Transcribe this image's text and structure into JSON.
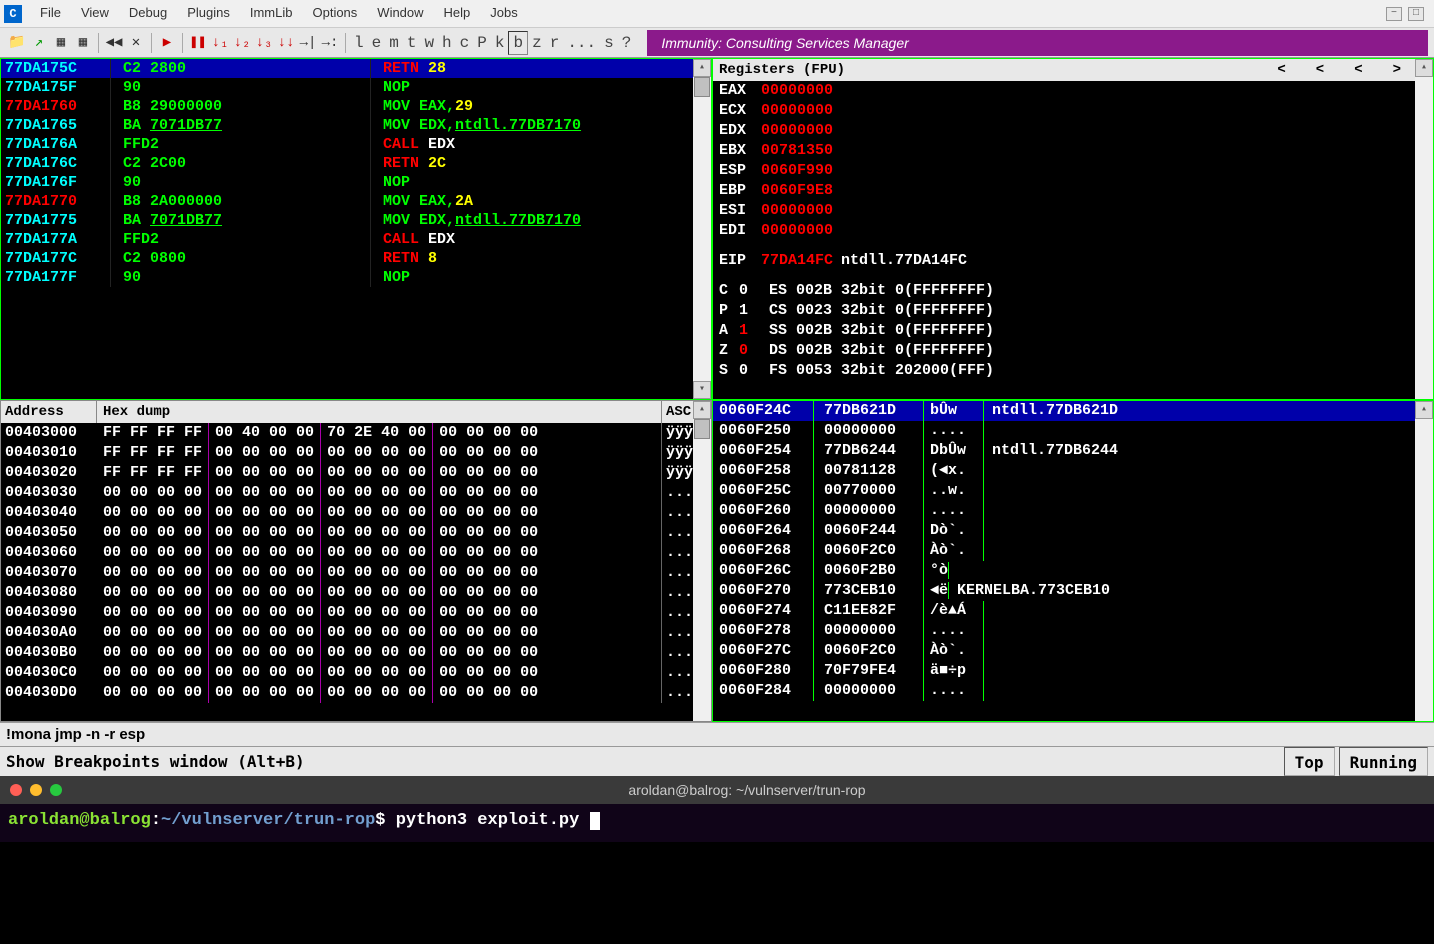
{
  "app_icon_letter": "C",
  "menu": [
    "File",
    "View",
    "Debug",
    "Plugins",
    "ImmLib",
    "Options",
    "Window",
    "Help",
    "Jobs"
  ],
  "toolbar_letters": [
    "l",
    "e",
    "m",
    "t",
    "w",
    "h",
    "c",
    "P",
    "k",
    "b",
    "z",
    "r",
    "...",
    "s",
    "?"
  ],
  "toolbar_active_letter": "b",
  "branding": "Immunity: Consulting Services Manager",
  "disasm": [
    {
      "addr": "77DA175C",
      "addr_c": "teal",
      "bytes": "C2 2800",
      "instr_parts": [
        {
          "t": "RETN ",
          "c": "red"
        },
        {
          "t": "28",
          "c": "yellow"
        }
      ],
      "sel": true
    },
    {
      "addr": "77DA175F",
      "addr_c": "teal",
      "bytes": "90",
      "instr_parts": [
        {
          "t": "NOP",
          "c": "green"
        }
      ]
    },
    {
      "addr": "77DA1760",
      "addr_c": "red",
      "bytes": "B8 29000000",
      "instr_parts": [
        {
          "t": "MOV EAX,",
          "c": "green"
        },
        {
          "t": "29",
          "c": "yellow"
        }
      ]
    },
    {
      "addr": "77DA1765",
      "addr_c": "teal",
      "bytes": "BA ",
      "bytes2": "7071DB77",
      "instr_parts": [
        {
          "t": "MOV EDX,",
          "c": "green"
        },
        {
          "t": "ntdll.77DB7170",
          "c": "green",
          "u": true
        }
      ]
    },
    {
      "addr": "77DA176A",
      "addr_c": "teal",
      "bytes": "FFD2",
      "instr_parts": [
        {
          "t": "CALL ",
          "c": "red"
        },
        {
          "t": "EDX",
          "c": "white"
        }
      ]
    },
    {
      "addr": "77DA176C",
      "addr_c": "teal",
      "bytes": "C2 2C00",
      "instr_parts": [
        {
          "t": "RETN ",
          "c": "red"
        },
        {
          "t": "2C",
          "c": "yellow"
        }
      ]
    },
    {
      "addr": "77DA176F",
      "addr_c": "teal",
      "bytes": "90",
      "instr_parts": [
        {
          "t": "NOP",
          "c": "green"
        }
      ]
    },
    {
      "addr": "77DA1770",
      "addr_c": "red",
      "bytes": "B8 2A000000",
      "instr_parts": [
        {
          "t": "MOV EAX,",
          "c": "green"
        },
        {
          "t": "2A",
          "c": "yellow"
        }
      ]
    },
    {
      "addr": "77DA1775",
      "addr_c": "teal",
      "bytes": "BA ",
      "bytes2": "7071DB77",
      "instr_parts": [
        {
          "t": "MOV EDX,",
          "c": "green"
        },
        {
          "t": "ntdll.77DB7170",
          "c": "green",
          "u": true
        }
      ]
    },
    {
      "addr": "77DA177A",
      "addr_c": "teal",
      "bytes": "FFD2",
      "instr_parts": [
        {
          "t": "CALL ",
          "c": "red"
        },
        {
          "t": "EDX",
          "c": "white"
        }
      ]
    },
    {
      "addr": "77DA177C",
      "addr_c": "teal",
      "bytes": "C2 0800",
      "instr_parts": [
        {
          "t": "RETN ",
          "c": "red"
        },
        {
          "t": "8",
          "c": "yellow"
        }
      ]
    },
    {
      "addr": "77DA177F",
      "addr_c": "teal",
      "bytes": "90",
      "instr_parts": [
        {
          "t": "NOP",
          "c": "green"
        }
      ]
    }
  ],
  "registers_title": "Registers (FPU)",
  "registers": [
    {
      "name": "EAX",
      "val": "00000000"
    },
    {
      "name": "ECX",
      "val": "00000000"
    },
    {
      "name": "EDX",
      "val": "00000000"
    },
    {
      "name": "EBX",
      "val": "00781350"
    },
    {
      "name": "ESP",
      "val": "0060F990"
    },
    {
      "name": "EBP",
      "val": "0060F9E8"
    },
    {
      "name": "ESI",
      "val": "00000000"
    },
    {
      "name": "EDI",
      "val": "00000000"
    }
  ],
  "eip_line": {
    "name": "EIP",
    "val": "77DA14FC",
    "extra": "ntdll.77DA14FC"
  },
  "flags": [
    {
      "n": "C",
      "v": "0",
      "seg": "ES 002B 32bit 0(FFFFFFFF)"
    },
    {
      "n": "P",
      "v": "1",
      "seg": "CS 0023 32bit 0(FFFFFFFF)"
    },
    {
      "n": "A",
      "v": "1",
      "vc": "red",
      "seg": "SS 002B 32bit 0(FFFFFFFF)"
    },
    {
      "n": "Z",
      "v": "0",
      "vc": "red",
      "seg": "DS 002B 32bit 0(FFFFFFFF)"
    },
    {
      "n": "S",
      "v": "0",
      "seg": "FS 0053 32bit 202000(FFF)"
    }
  ],
  "hex_headers": {
    "addr": "Address",
    "dump": "Hex dump",
    "asc": "ASC"
  },
  "hex_rows": [
    {
      "a": "00403000",
      "g": [
        "FF FF FF FF",
        "00 40 00 00",
        "70 2E 40 00",
        "00 00 00 00"
      ],
      "asc": "ÿÿÿÿ"
    },
    {
      "a": "00403010",
      "g": [
        "FF FF FF FF",
        "00 00 00 00",
        "00 00 00 00",
        "00 00 00 00"
      ],
      "asc": "ÿÿÿÿ"
    },
    {
      "a": "00403020",
      "g": [
        "FF FF FF FF",
        "00 00 00 00",
        "00 00 00 00",
        "00 00 00 00"
      ],
      "asc": "ÿÿÿÿ"
    },
    {
      "a": "00403030",
      "g": [
        "00 00 00 00",
        "00 00 00 00",
        "00 00 00 00",
        "00 00 00 00"
      ],
      "asc": "...."
    },
    {
      "a": "00403040",
      "g": [
        "00 00 00 00",
        "00 00 00 00",
        "00 00 00 00",
        "00 00 00 00"
      ],
      "asc": "...."
    },
    {
      "a": "00403050",
      "g": [
        "00 00 00 00",
        "00 00 00 00",
        "00 00 00 00",
        "00 00 00 00"
      ],
      "asc": "...."
    },
    {
      "a": "00403060",
      "g": [
        "00 00 00 00",
        "00 00 00 00",
        "00 00 00 00",
        "00 00 00 00"
      ],
      "asc": "...."
    },
    {
      "a": "00403070",
      "g": [
        "00 00 00 00",
        "00 00 00 00",
        "00 00 00 00",
        "00 00 00 00"
      ],
      "asc": "...."
    },
    {
      "a": "00403080",
      "g": [
        "00 00 00 00",
        "00 00 00 00",
        "00 00 00 00",
        "00 00 00 00"
      ],
      "asc": "...."
    },
    {
      "a": "00403090",
      "g": [
        "00 00 00 00",
        "00 00 00 00",
        "00 00 00 00",
        "00 00 00 00"
      ],
      "asc": "...."
    },
    {
      "a": "004030A0",
      "g": [
        "00 00 00 00",
        "00 00 00 00",
        "00 00 00 00",
        "00 00 00 00"
      ],
      "asc": "...."
    },
    {
      "a": "004030B0",
      "g": [
        "00 00 00 00",
        "00 00 00 00",
        "00 00 00 00",
        "00 00 00 00"
      ],
      "asc": "...."
    },
    {
      "a": "004030C0",
      "g": [
        "00 00 00 00",
        "00 00 00 00",
        "00 00 00 00",
        "00 00 00 00"
      ],
      "asc": "...."
    },
    {
      "a": "004030D0",
      "g": [
        "00 00 00 00",
        "00 00 00 00",
        "00 00 00 00",
        "00 00 00 00"
      ],
      "asc": "...."
    }
  ],
  "stack": [
    {
      "a": "0060F24C",
      "v": "77DB621D",
      "asc": "bÛw",
      "sym": "ntdll.77DB621D",
      "sel": true
    },
    {
      "a": "0060F250",
      "v": "00000000",
      "asc": "....",
      "sym": ""
    },
    {
      "a": "0060F254",
      "v": "77DB6244",
      "asc": "DbÛw",
      "sym": "ntdll.77DB6244"
    },
    {
      "a": "0060F258",
      "v": "00781128",
      "asc": "(◄x.",
      "sym": ""
    },
    {
      "a": "0060F25C",
      "v": "00770000",
      "asc": "..w.",
      "sym": ""
    },
    {
      "a": "0060F260",
      "v": "00000000",
      "asc": "....",
      "sym": ""
    },
    {
      "a": "0060F264",
      "v": "0060F244",
      "asc": "Dò`.",
      "sym": ""
    },
    {
      "a": "0060F268",
      "v": "0060F2C0",
      "asc": "Àò`.",
      "sym": ""
    },
    {
      "a": "0060F26C",
      "v": "0060F2B0",
      "asc": "°ò<w",
      "sym": ""
    },
    {
      "a": "0060F270",
      "v": "773CEB10",
      "asc": "◄ë<w",
      "sym": "KERNELBA.773CEB10"
    },
    {
      "a": "0060F274",
      "v": "C11EE82F",
      "asc": "/è▲Á",
      "sym": ""
    },
    {
      "a": "0060F278",
      "v": "00000000",
      "asc": "....",
      "sym": ""
    },
    {
      "a": "0060F27C",
      "v": "0060F2C0",
      "asc": "Àò`.",
      "sym": ""
    },
    {
      "a": "0060F280",
      "v": "70F79FE4",
      "asc": "ä■÷p",
      "sym": ""
    },
    {
      "a": "0060F284",
      "v": "00000000",
      "asc": "....",
      "sym": ""
    }
  ],
  "cmdline": "!mona jmp -n -r esp",
  "status": {
    "main": "Show Breakpoints window (Alt+B)",
    "top": "Top",
    "running": "Running"
  },
  "terminal": {
    "title": "aroldan@balrog: ~/vulnserver/trun-rop",
    "user": "aroldan@balrog",
    "path": "~/vulnserver/trun-rop",
    "cmd": "python3 exploit.py "
  }
}
